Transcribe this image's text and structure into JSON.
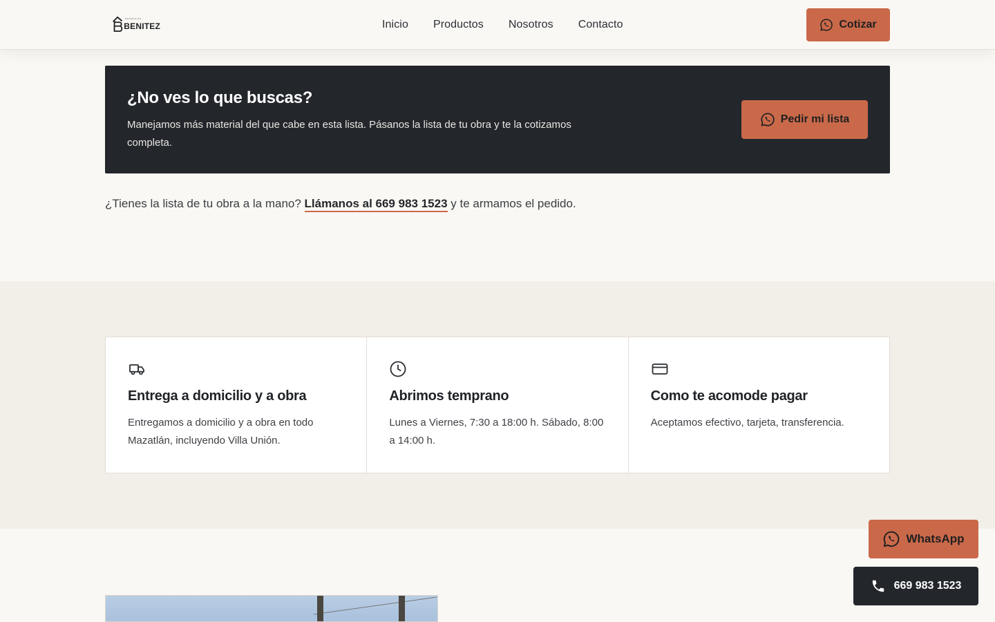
{
  "header": {
    "logo_text": "BENITEZ",
    "logo_sub": "MATERIALES",
    "nav": [
      "Inicio",
      "Productos",
      "Nosotros",
      "Contacto"
    ],
    "cta_label": "Cotizar",
    "cta_icon": "whatsapp-icon"
  },
  "banner": {
    "title": "¿No ves lo que buscas?",
    "text": "Manejamos más material del que cabe en esta lista. Pásanos la lista de tu obra y te la cotizamos completa.",
    "button_label": "Pedir mi lista",
    "button_icon": "whatsapp-icon"
  },
  "call": {
    "prefix": "¿Tienes la lista de tu obra a la mano?",
    "link": "Llámanos al 669 983 1523",
    "suffix": "y te armamos el pedido."
  },
  "features": [
    {
      "icon": "truck-icon",
      "title": "Entrega a domicilio y a obra",
      "text": "Entregamos a domicilio y a obra en todo Mazatlán, incluyendo Villa Unión."
    },
    {
      "icon": "clock-icon",
      "title": "Abrimos temprano",
      "text": "Lunes a Viernes, 7:30 a 18:00 h. Sábado, 8:00 a 14:00 h."
    },
    {
      "icon": "credit-card-icon",
      "title": "Como te acomode pagar",
      "text": "Aceptamos efectivo, tarjeta, transferencia."
    }
  ],
  "floating": {
    "whatsapp_label": "WhatsApp",
    "phone_label": "669 983 1523"
  },
  "colors": {
    "accent": "#c9694a",
    "dark": "#23272c",
    "page_bg": "#faf8f4",
    "section_bg": "#f2efe8"
  }
}
